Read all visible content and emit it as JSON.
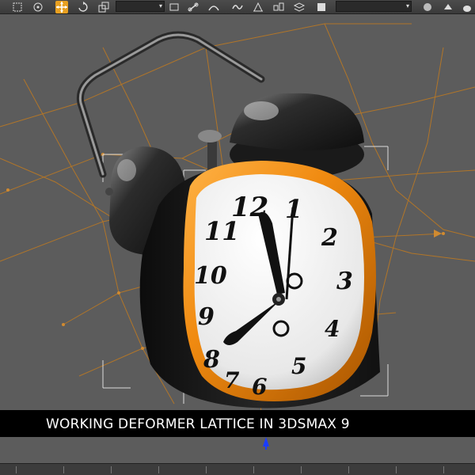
{
  "toolbar": {
    "icons": [
      "select-region-icon",
      "snap-icon",
      "move-icon",
      "rotate-icon",
      "scale-icon",
      "view-icon",
      "link-icon",
      "bind-icon",
      "curve-icon",
      "mirror-icon",
      "align-icon",
      "layers-icon",
      "render-icon",
      "teapot-icon"
    ],
    "active_tool": "move-icon",
    "colors": {
      "active": "#e8a020"
    }
  },
  "viewport": {
    "clock_numerals": [
      "12",
      "1",
      "2",
      "3",
      "4",
      "5",
      "6",
      "7",
      "8",
      "9",
      "10",
      "11"
    ],
    "colors": {
      "background": "#5c5c5c",
      "clock_body": "#1e1e1e",
      "bezel": "#f08a10",
      "face": "#f4f4f4",
      "lattice": "#c07a20",
      "bounding_box": "#dddddd"
    }
  },
  "caption": {
    "text": "WORKING DEFORMER LATTICE IN 3DSMAX 9"
  }
}
